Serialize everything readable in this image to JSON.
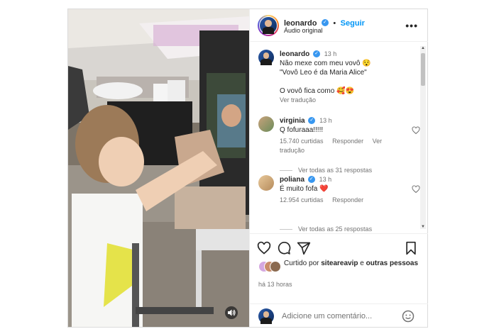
{
  "header": {
    "username": "leonardo",
    "follow_label": "Seguir",
    "subtitle": "Áudio original",
    "more_glyph": "•••"
  },
  "caption": {
    "username": "leonardo",
    "time": "13 h",
    "line1": "Não mexe com meu vovô 😯",
    "line2": "\"Vovô Leo é da Maria Alice\"",
    "line3": "O vovô fica como 🥰😍",
    "translate": "Ver tradução"
  },
  "comments": [
    {
      "username": "virginia",
      "time": "13 h",
      "text": "Q fofuraaa!!!!!",
      "likes": "15.740 curtidas",
      "reply": "Responder",
      "translate": "Ver tradução",
      "view_replies": "Ver todas as 31 respostas"
    },
    {
      "username": "poliana",
      "time": "13 h",
      "text": "É muito fofa ❤️",
      "likes": "12.954 curtidas",
      "reply": "Responder",
      "view_replies": "Ver todas as 25 respostas"
    }
  ],
  "liked_by": {
    "prefix": "Curtido por",
    "user": "sitearea­vip",
    "suffix": "e",
    "others": "outras pessoas"
  },
  "time_ago": "há 13 horas",
  "comment_input": {
    "placeholder": "Adicione um comentário..."
  },
  "colors": {
    "accent": "#0095f6",
    "verified": "#3897f0",
    "heart_red": "#ed4956"
  },
  "icons": [
    "like-icon",
    "comment-icon",
    "share-icon",
    "save-icon",
    "emoji-icon",
    "sound-icon",
    "more-icon",
    "verified-icon"
  ]
}
